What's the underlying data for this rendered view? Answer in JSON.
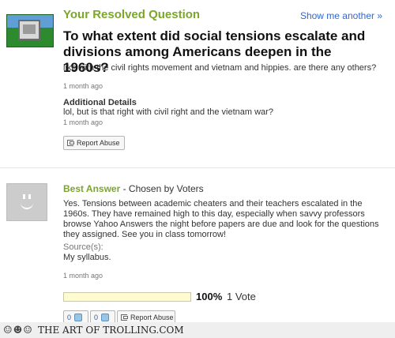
{
  "header": {
    "title": "Your Resolved Question",
    "show_another": "Show me another »"
  },
  "question": {
    "title": "To what extent did social tensions escalate and divisions among Americans deepen in the 1960s?",
    "body": "like with the civil rights movement and vietnam and hippies. are there any others?",
    "time": "1 month ago",
    "additional_heading": "Additional Details",
    "additional_body": "lol, but is that right with civil right and the vietnam war?",
    "additional_time": "1 month ago",
    "report_label": "Report Abuse"
  },
  "answer": {
    "heading": "Best Answer",
    "chosen_by": " - Chosen by Voters",
    "body": "Yes. Tensions between academic cheaters and their teachers escalated in the 1960s. They have remained high to this day, especially when savvy professors browse Yahoo Answers the night before papers are due and look for the questions they assigned. See you in class tomorrow!",
    "source_label": "Source(s):",
    "source_value": "My syllabus.",
    "time": "1 month ago",
    "vote_percent": "100%",
    "vote_count": "1 Vote",
    "vote_fraction": 1.0,
    "thumbs_up_count": "0",
    "thumbs_down_count": "0",
    "report_label": "Report Abuse"
  },
  "footer": {
    "banner": "THE ART OF TROLLING.COM"
  },
  "colors": {
    "accent_green": "#7aa62a",
    "link_blue": "#3366cc"
  }
}
